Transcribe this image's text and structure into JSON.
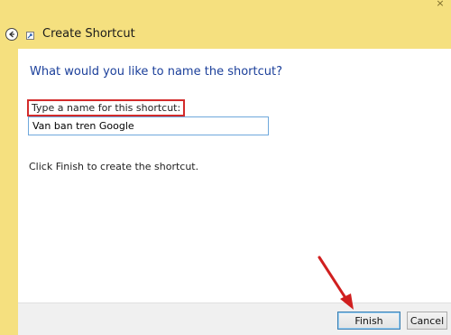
{
  "window": {
    "title": "Create Shortcut",
    "close_glyph": "×"
  },
  "main": {
    "heading": "What would you like to name the shortcut?",
    "field_label": "Type a name for this shortcut:",
    "name_value": "Van ban tren Google",
    "hint": "Click Finish to create the shortcut."
  },
  "footer": {
    "finish_label": "Finish",
    "cancel_label": "Cancel"
  },
  "colors": {
    "accent_frame": "#f5e07f",
    "heading": "#1b3f9a",
    "highlight_box": "#d32b2b",
    "annotation_arrow": "#d01f1f"
  },
  "icons": [
    "back-arrow-icon",
    "shortcut-icon",
    "close-icon",
    "annotation-arrow-icon"
  ]
}
